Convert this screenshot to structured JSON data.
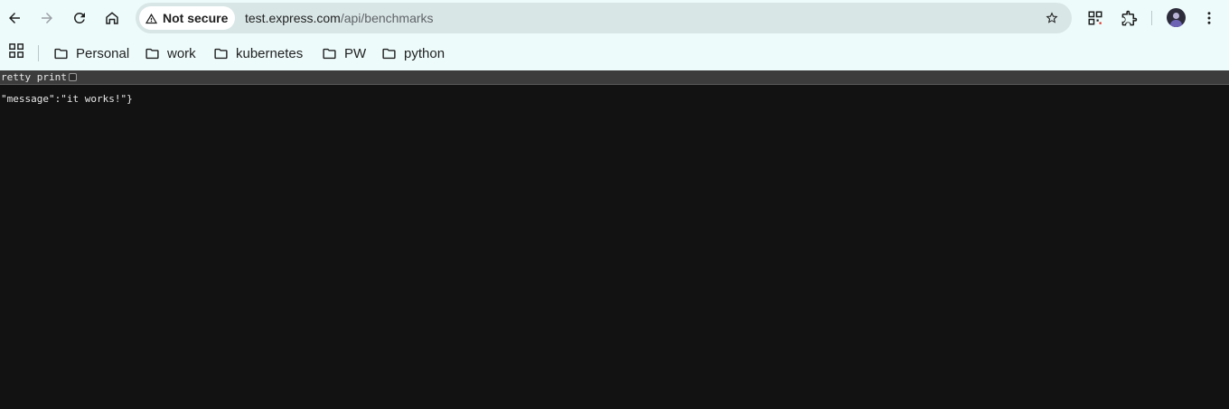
{
  "browser": {
    "security_label": "Not secure",
    "url_host": "test.express.com",
    "url_path": "/api/benchmarks",
    "bookmarks": [
      {
        "label": "Personal"
      },
      {
        "label": "work"
      },
      {
        "label": "kubernetes"
      },
      {
        "label": "PW"
      },
      {
        "label": "python"
      }
    ]
  },
  "page": {
    "pretty_print_label": "retty print",
    "pretty_print_checked": false,
    "json_text": "\"message\":\"it works!\"}"
  }
}
